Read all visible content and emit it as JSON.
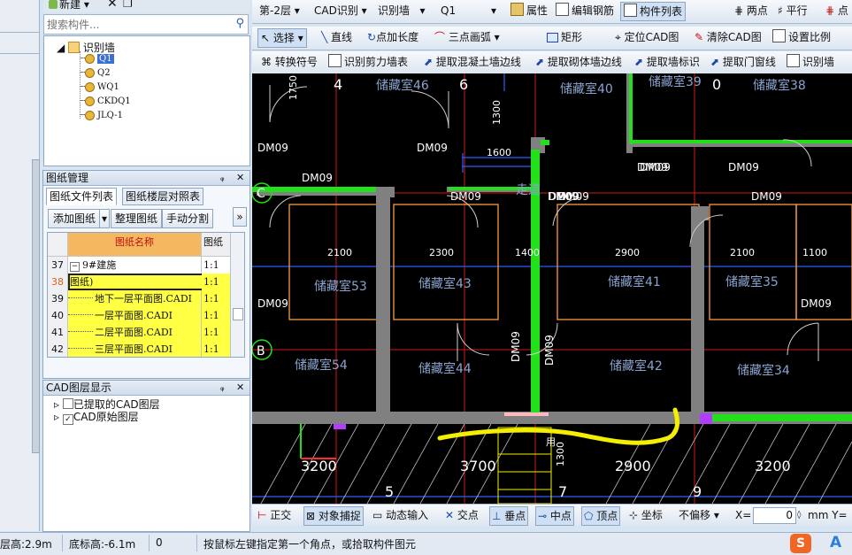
{
  "top_left": {
    "new_label": "新建",
    "search_placeholder": "搜索构件..."
  },
  "component_tree": {
    "root": "识别墙",
    "items": [
      "Q1",
      "Q2",
      "WQ1",
      "CKDQ1",
      "JLQ-1"
    ]
  },
  "drawing_panel": {
    "title": "图纸管理",
    "tabs": [
      "图纸文件列表",
      "图纸楼层对照表"
    ],
    "buttons": [
      "添加图纸",
      "整理图纸",
      "手动分割"
    ],
    "more": "»",
    "columns": [
      "图纸名称",
      "图纸"
    ],
    "rows": [
      {
        "num": "37",
        "name": "9#建施",
        "scale": "1:1",
        "expander": "−",
        "highlight": false
      },
      {
        "num": "38",
        "name": "图纸)",
        "scale": "1:1",
        "expander": "",
        "highlight": true
      },
      {
        "num": "39",
        "name": "地下一层平面图.CADI",
        "scale": "1:1",
        "expander": "",
        "highlight": true
      },
      {
        "num": "40",
        "name": "一层平面图.CADI",
        "scale": "1:1",
        "expander": "",
        "highlight": true
      },
      {
        "num": "41",
        "name": "二层平面图.CADI",
        "scale": "1:1",
        "expander": "",
        "highlight": true
      },
      {
        "num": "42",
        "name": "三层平面图.CADI",
        "scale": "1:1",
        "expander": "",
        "highlight": true
      }
    ]
  },
  "cad_layers": {
    "title": "CAD图层显示",
    "items": [
      {
        "label": "已提取的CAD图层",
        "checked": false
      },
      {
        "label": "CAD原始图层",
        "checked": true
      }
    ]
  },
  "toolbar1": {
    "floor": "第-2层",
    "cad_recognize": "CAD识别",
    "recognize_wall": "识别墙",
    "component": "Q1",
    "properties": "属性",
    "edit_rebar": "编辑钢筋",
    "component_list": "构件列表",
    "two_points": "两点",
    "parallel": "平行",
    "point_angle": "点"
  },
  "toolbar2": {
    "select": "选择",
    "line": "直线",
    "point_length": "点加长度",
    "three_point_arc": "三点画弧",
    "rectangle": "矩形",
    "locate_cad": "定位CAD图",
    "clear_cad": "清除CAD图",
    "set_scale": "设置比例"
  },
  "toolbar3": {
    "convert_symbol": "转换符号",
    "recognize_shear_wall": "识别剪力墙表",
    "extract_concrete_wall": "提取混凝土墙边线",
    "extract_masonry_wall": "提取砌体墙边线",
    "extract_wall_label": "提取墙标识",
    "extract_door_window": "提取门窗线",
    "recognize_wall": "识别墙"
  },
  "canvas": {
    "rooms": [
      "储藏室46",
      "储藏室40",
      "储藏室39",
      "储藏室38",
      "储藏室53",
      "储藏室43",
      "储藏室41",
      "储藏室35",
      "储藏室54",
      "储藏室44",
      "储藏室42",
      "储藏室34"
    ],
    "corridor": "走道",
    "doors": [
      "DM09",
      "DM09",
      "DM09",
      "DM09",
      "DM09",
      "DM09",
      "DM09",
      "DM09",
      "DM09",
      "DM09",
      "DM09",
      "DM09",
      "DM09"
    ],
    "vertical_doors": [
      "DM09",
      "DM09"
    ],
    "dimensions": [
      "2100",
      "2300",
      "1400",
      "2900",
      "2100",
      "1100",
      "1600",
      "1300",
      "1750",
      "1300"
    ],
    "bottom_dimensions": [
      "3200",
      "3700",
      "2900",
      "3200"
    ],
    "grid_numbers": [
      "4",
      "6",
      "0",
      "5",
      "7",
      "9"
    ],
    "grid_letters": [
      "C",
      "B"
    ],
    "stair_text": "用"
  },
  "snapbar": {
    "ortho": "正交",
    "object_snap": "对象捕捉",
    "dynamic_input": "动态输入",
    "intersection": "交点",
    "perpendicular": "垂点",
    "midpoint": "中点",
    "vertex": "顶点",
    "coordinate": "坐标",
    "offset": "不偏移",
    "x_label": "X=",
    "x_value": "0",
    "mm_y": "mm Y="
  },
  "statusbar": {
    "floor_height": "层高:2.9m",
    "bottom_elevation": "底标高:-6.1m",
    "value": "0",
    "hint": "按鼠标左键指定第一个角点，或拾取构件图元"
  },
  "colors": {
    "wall_gray": "#808080",
    "wall_green": "#22e01a",
    "grid_red": "#d01818",
    "axis_blue": "#2a5cff",
    "door_orange": "#ff9a3c",
    "room_text": "#8aa3cf",
    "annotation_yellow": "#f4ef00"
  }
}
